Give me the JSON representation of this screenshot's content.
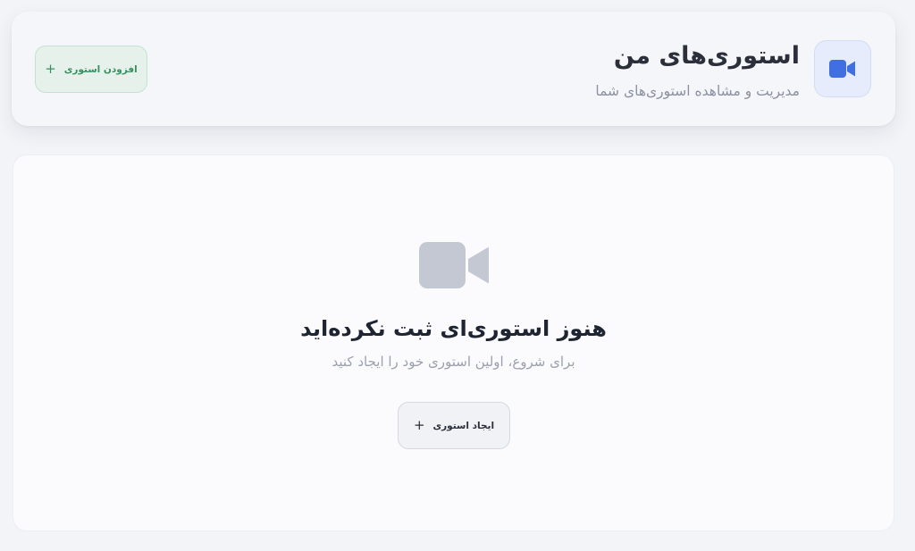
{
  "header": {
    "title": "استوری‌های من",
    "subtitle": "مدیریت و مشاهده استوری‌های شما",
    "icon": "video-camera-icon",
    "add_button_label": "افزودن استوری",
    "add_button_icon": "plus-icon"
  },
  "empty_state": {
    "icon": "video-camera-icon",
    "title": "هنوز استوری‌ای ثبت نکرده‌اید",
    "subtitle": "برای شروع، اولین استوری خود را ایجاد کنید",
    "create_button_label": "ایجاد استوری",
    "create_button_icon": "plus-icon"
  },
  "colors": {
    "accent_blue": "#3f6fe3",
    "success_green": "#3a8f5f",
    "muted_icon": "#c3c8d3",
    "background": "#f3f4f8"
  }
}
